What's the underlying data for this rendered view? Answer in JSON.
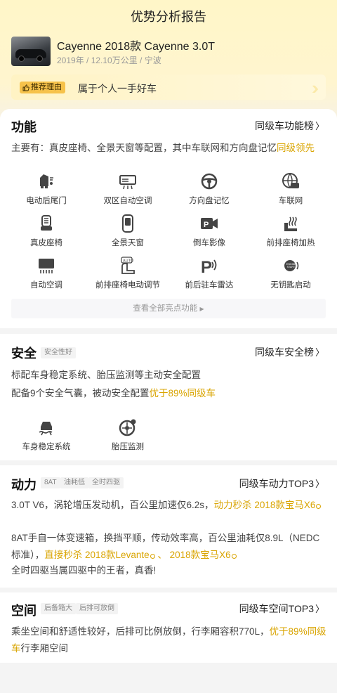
{
  "header": {
    "title": "优势分析报告",
    "car_name": "Cayenne 2018款 Cayenne 3.0T",
    "car_meta": "2019年 / 12.10万公里 / 宁波",
    "reason_badge": "推荐理由",
    "reason_text": "属于个人一手好车"
  },
  "function": {
    "title": "功能",
    "rank_link": "同级车功能榜",
    "summary_prefix": "主要有：真皮座椅、全景天窗等配置，其中车联网和方向盘记忆",
    "summary_highlight": "同级领先",
    "features": [
      {
        "label": "电动后尾门",
        "icon": "tailgate-icon"
      },
      {
        "label": "双区自动空调",
        "icon": "dual-zone-ac-icon"
      },
      {
        "label": "方向盘记忆",
        "icon": "steering-wheel-icon"
      },
      {
        "label": "车联网",
        "icon": "connected-car-icon"
      },
      {
        "label": "真皮座椅",
        "icon": "leather-seat-icon"
      },
      {
        "label": "全景天窗",
        "icon": "panoramic-sunroof-icon"
      },
      {
        "label": "倒车影像",
        "icon": "reverse-camera-icon"
      },
      {
        "label": "前排座椅加热",
        "icon": "seat-heating-icon"
      },
      {
        "label": "自动空调",
        "icon": "auto-ac-icon"
      },
      {
        "label": "前排座椅电动调节",
        "icon": "power-seat-icon"
      },
      {
        "label": "前后驻车雷达",
        "icon": "parking-radar-icon"
      },
      {
        "label": "无钥匙启动",
        "icon": "keyless-start-icon"
      }
    ],
    "more_label": "查看全部亮点功能"
  },
  "safety": {
    "title": "安全",
    "tag": "安全性好",
    "rank_link": "同级车安全榜",
    "line1": "标配车身稳定系统、胎压监测等主动安全配置",
    "line2_prefix": "配备9个安全气囊，被动安全配置",
    "line2_highlight": "优于89%同级车",
    "features": [
      {
        "label": "车身稳定系统",
        "icon": "stability-control-icon"
      },
      {
        "label": "胎压监测",
        "icon": "tire-pressure-icon"
      }
    ]
  },
  "power": {
    "title": "动力",
    "tags": [
      "8AT",
      "油耗低",
      "全时四驱"
    ],
    "rank_link": "同级车动力TOP3",
    "line1_prefix": "3.0T V6，涡轮增压发动机，百公里加速仅6.2s，",
    "line1_highlight": "动力秒杀",
    "line1_link": "2018款宝马X6",
    "line2_prefix": "8AT手自一体变速箱，换挡平顺，传动效率高，百公里油耗仅8.9L（NEDC标准），",
    "line2_highlight": "直接秒杀",
    "line2_link1": "2018款Levante",
    "line2_sep": "、",
    "line2_link2": "2018款宝马X6",
    "line3": "全时四驱当属四驱中的王者，真香!"
  },
  "space": {
    "title": "空间",
    "tags": [
      "后备箱大",
      "后排可放倒"
    ],
    "rank_link": "同级车空间TOP3",
    "text_prefix": "乘坐空间和舒适性较好，后排可比例放倒，行李厢容积770L，",
    "text_highlight": "优于89%同级车",
    "text_suffix": "行李厢空间"
  },
  "colors": {
    "accent": "#d9a400",
    "badge": "#f6c24a",
    "icon": "#444444"
  }
}
